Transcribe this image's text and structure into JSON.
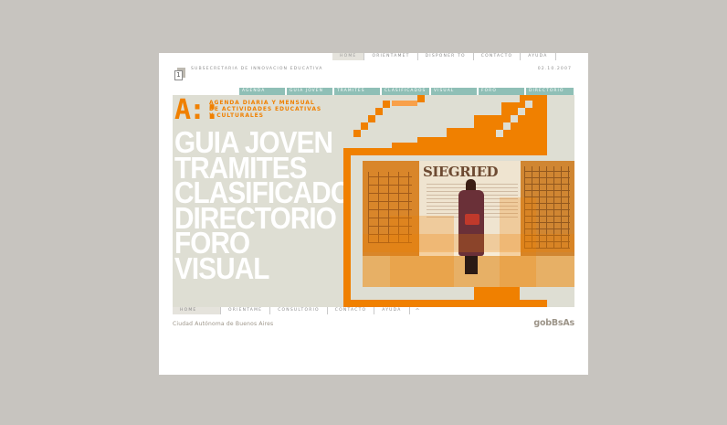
{
  "top_nav": [
    {
      "label": "HOME",
      "active": true
    },
    {
      "label": "ORIENTAMET"
    },
    {
      "label": "DISPONER TO"
    },
    {
      "label": "CONTACTO"
    },
    {
      "label": "AYUDA"
    }
  ],
  "header": {
    "org_label": "SUBSECRETARIA DE INNOVACION EDUCATIVA",
    "date": "02.10.2007"
  },
  "tabs": [
    "AGENDA",
    "GUIA JOVEN",
    "TRAMITES",
    "CLASIFICADOS",
    "VISUAL",
    "FORO",
    "DIRECTORIO"
  ],
  "hero": {
    "logo_letter": "A::",
    "tagline": "AGENDA DIARIA Y MENSUAL DE ACTIVIDADES EDUCATIVAS Y CULTURALES",
    "menu": [
      "GUIA JOVEN",
      "TRAMITES",
      "CLASIFICADOS",
      "DIRECTORIO",
      "FORO",
      "VISUAL"
    ],
    "photo_title": "SIEGRIED"
  },
  "bottom_nav": [
    {
      "label": "HOME",
      "active": true
    },
    {
      "label": "ORIENTAME"
    },
    {
      "label": "CONSULTORIO"
    },
    {
      "label": "CONTACTO"
    },
    {
      "label": "AYUDA"
    }
  ],
  "footer": {
    "city": "Ciudad Autónoma de Buenos Aires",
    "brand": "gobBsAs"
  },
  "colors": {
    "accent": "#f08000",
    "tab": "#8fbfb6",
    "hero_bg": "#deded3",
    "outer_bg": "#c7c4bf"
  }
}
